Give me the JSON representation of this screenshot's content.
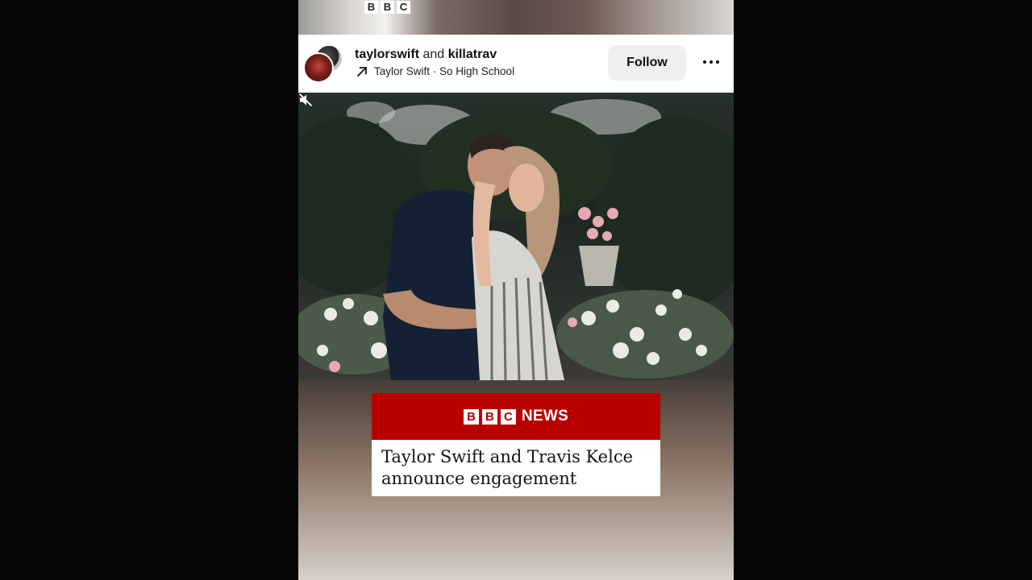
{
  "top_logo": {
    "letters": [
      "B",
      "B",
      "C"
    ]
  },
  "post": {
    "user1": "taylorswift",
    "conjunction": "and",
    "user2": "killatrav",
    "audio": "Taylor Swift · So High School",
    "follow_label": "Follow"
  },
  "news_card": {
    "logo_letters": [
      "B",
      "B",
      "C"
    ],
    "brand_word": "NEWS",
    "headline": "Taylor Swift and Travis Kelce announce engagement"
  },
  "colors": {
    "bbc_red": "#b80000",
    "follow_bg": "#efefef"
  },
  "icons": {
    "audio": "arrow-up-right-icon",
    "more": "more-horizontal-icon",
    "mute": "speaker-muted-icon"
  }
}
